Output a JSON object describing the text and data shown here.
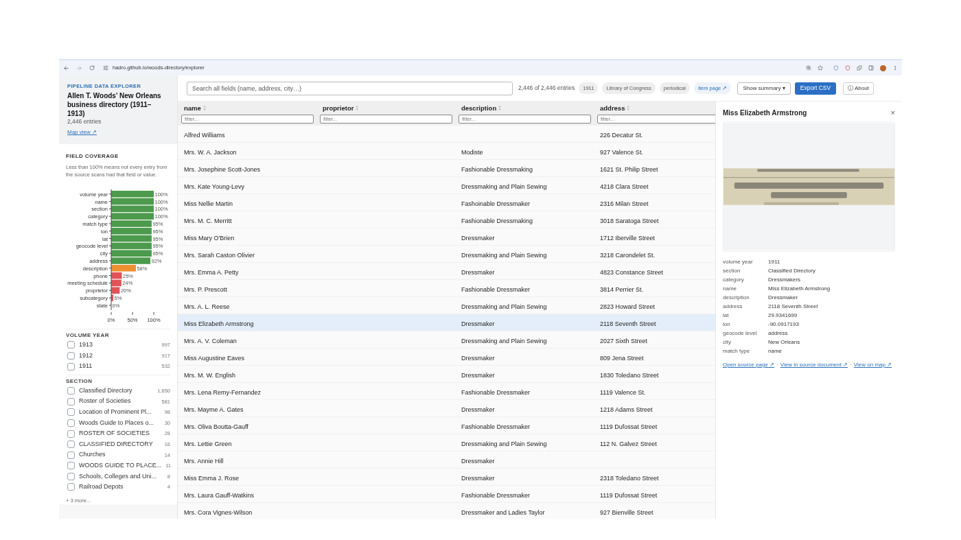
{
  "browser": {
    "url": "hadro.github.io/woods-directory/explorer"
  },
  "sidebar": {
    "eyebrow": "PIPELINE DATA EXPLORER",
    "title": "Allen T. Woods' New Orleans business directory (1911–1913)",
    "entries": "2,446 entries",
    "map_link": "Map view ↗",
    "coverage": {
      "heading": "FIELD COVERAGE",
      "note": "Less than 100% means not every entry from the source scans had that field or value.",
      "chart_data": {
        "type": "bar",
        "orientation": "horizontal",
        "categories": [
          "volume year",
          "name",
          "section",
          "category",
          "match type",
          "lon",
          "lat",
          "geocode level",
          "city",
          "address",
          "description",
          "phone",
          "meeting schedule",
          "proprietor",
          "subcategory",
          "state"
        ],
        "values": [
          100,
          100,
          100,
          100,
          95,
          95,
          95,
          95,
          95,
          92,
          58,
          25,
          24,
          20,
          5,
          0
        ],
        "value_labels": [
          "100%",
          "100%",
          "100%",
          "100%",
          "95%",
          "95%",
          "95%",
          "95%",
          "95%",
          "92%",
          "58%",
          "25%",
          "24%",
          "20%",
          "5%",
          "0%"
        ],
        "xlim": [
          0,
          100
        ],
        "xticks": [
          {
            "value": 0,
            "label": "0%"
          },
          {
            "value": 50,
            "label": "50%"
          },
          {
            "value": 100,
            "label": "100%"
          }
        ]
      }
    },
    "facets": [
      {
        "heading": "VOLUME YEAR",
        "items": [
          {
            "label": "1913",
            "count": "997",
            "checked": false
          },
          {
            "label": "1912",
            "count": "917",
            "checked": false
          },
          {
            "label": "1911",
            "count": "532",
            "checked": false
          }
        ]
      },
      {
        "heading": "SECTION",
        "items": [
          {
            "label": "Classified Directory",
            "count": "1,650",
            "checked": false
          },
          {
            "label": "Roster of Societies",
            "count": "581",
            "checked": false
          },
          {
            "label": "Location of Prominent Pl...",
            "count": "98",
            "checked": false
          },
          {
            "label": "Woods Guide to Places o...",
            "count": "30",
            "checked": false
          },
          {
            "label": "ROSTER OF SOCIETIES",
            "count": "28",
            "checked": false
          },
          {
            "label": "CLASSIFIED DIRECTORY",
            "count": "16",
            "checked": false
          },
          {
            "label": "Churches",
            "count": "14",
            "checked": false
          },
          {
            "label": "WOODS GUIDE TO PLACE...",
            "count": "11",
            "checked": false
          },
          {
            "label": "Schools, Colleges and Uni...",
            "count": "8",
            "checked": false
          },
          {
            "label": "Railroad Depots",
            "count": "4",
            "checked": false
          }
        ],
        "more": "+ 3 more..."
      }
    ]
  },
  "toolbar": {
    "search_placeholder": "Search all fields (name, address, city…)",
    "count": "2,446 of 2,446 entries",
    "tags": [
      "1911",
      "Library of Congress",
      "periodical"
    ],
    "item_link": "Item page ↗",
    "summary_button": "Show summary ▾",
    "export_button": "Export CSV",
    "about_button": "ⓘ About"
  },
  "table": {
    "columns": [
      {
        "label": "name",
        "filter_placeholder": "filter..."
      },
      {
        "label": "proprietor",
        "filter_placeholder": "filter..."
      },
      {
        "label": "description",
        "filter_placeholder": "filter..."
      },
      {
        "label": "address",
        "filter_placeholder": "filter..."
      }
    ],
    "rows": [
      {
        "cells": [
          "Alfred Williams",
          "",
          "",
          "226 Decatur St."
        ],
        "selected": false
      },
      {
        "cells": [
          "Mrs. W. A. Jackson",
          "",
          "Modiste",
          "927 Valence St."
        ],
        "selected": false
      },
      {
        "cells": [
          "Mrs. Josephine Scott-Jones",
          "",
          "Fashionable Dressmaking",
          "1621 St. Philip Street"
        ],
        "selected": false
      },
      {
        "cells": [
          "Mrs. Kate Young-Levy",
          "",
          "Dressmaking and Plain Sewing",
          "4218 Clara Street"
        ],
        "selected": false
      },
      {
        "cells": [
          "Miss Nellie Martin",
          "",
          "Fashoinable Dressmaker",
          "2316 Milan Street"
        ],
        "selected": false
      },
      {
        "cells": [
          "Mrs. M. C. Merritt",
          "",
          "Fashionable Dressmaking",
          "3018 Saratoga Street"
        ],
        "selected": false
      },
      {
        "cells": [
          "Miss Mary O'Brien",
          "",
          "Dressmaker",
          "1712 Iberville Street"
        ],
        "selected": false
      },
      {
        "cells": [
          "Mrs. Sarah Caston Olivier",
          "",
          "Dressmaking and Plain Sewing",
          "3218 Carondelet St."
        ],
        "selected": false
      },
      {
        "cells": [
          "Mrs. Emma A. Petty",
          "",
          "Dressmaker",
          "4823 Constance Street"
        ],
        "selected": false
      },
      {
        "cells": [
          "Mrs. P. Prescott",
          "",
          "Fashionable Dressmaker",
          "3814 Perrier St."
        ],
        "selected": false
      },
      {
        "cells": [
          "Mrs. A. L. Reese",
          "",
          "Dressmaking and Plain Sewing",
          "2823 Howard Street"
        ],
        "selected": false
      },
      {
        "cells": [
          "Miss Elizabeth Armstrong",
          "",
          "Dressmaker",
          "2118 Seventh Street"
        ],
        "selected": true
      },
      {
        "cells": [
          "Mrs. A. V. Coleman",
          "",
          "Dressmaking and Plain Sewing",
          "2027 Sixth Street"
        ],
        "selected": false
      },
      {
        "cells": [
          "Miss Augustine Eaves",
          "",
          "Dressmaker",
          "809 Jena Street"
        ],
        "selected": false
      },
      {
        "cells": [
          "Mrs. M. W. English",
          "",
          "Dressmaker",
          "1830 Toledano Street"
        ],
        "selected": false
      },
      {
        "cells": [
          "Mrs. Lena Remy-Fernandez",
          "",
          "Fashionable Dressmaker",
          "1119 Valence St."
        ],
        "selected": false
      },
      {
        "cells": [
          "Mrs. Mayme A. Gates",
          "",
          "Dressmaker",
          "1218 Adams Street"
        ],
        "selected": false
      },
      {
        "cells": [
          "Mrs. Oliva Boutta-Gauff",
          "",
          "Fashionable Dressmaker",
          "1119 Dufossat Street"
        ],
        "selected": false
      },
      {
        "cells": [
          "Mrs. Lettie Green",
          "",
          "Dressmaking and Plain Sewing",
          "112 N. Galvez Street"
        ],
        "selected": false
      },
      {
        "cells": [
          "Mrs. Annie Hill",
          "",
          "Dressmaker",
          ""
        ],
        "selected": false
      },
      {
        "cells": [
          "Miss Emma J. Rose",
          "",
          "Dressmaker",
          "2318 Toledano Street"
        ],
        "selected": false
      },
      {
        "cells": [
          "Mrs. Laura Gauff-Watkins",
          "",
          "Fashionable Dressmaker",
          "1119 Dufossat Street"
        ],
        "selected": false
      },
      {
        "cells": [
          "Mrs. Cora Vignes-Wilson",
          "",
          "Dressmaker and Ladies Taylor",
          "927 Bienville Street"
        ],
        "selected": false
      }
    ]
  },
  "detail": {
    "title": "Miss Elizabeth Armstrong",
    "close": "×",
    "image": {
      "kind": "picture"
    },
    "fields": [
      {
        "key": "volume year",
        "value": "1911"
      },
      {
        "key": "section",
        "value": "Classified Directory"
      },
      {
        "key": "category",
        "value": "Dressmakers"
      },
      {
        "key": "name",
        "value": "Miss Elizabeth Armstrong"
      },
      {
        "key": "description",
        "value": "Dressmaker"
      },
      {
        "key": "address",
        "value": "2118 Seventh Street"
      },
      {
        "key": "lat",
        "value": "29.9341699"
      },
      {
        "key": "lon",
        "value": "-90.0917193"
      },
      {
        "key": "geocode level",
        "value": "address"
      },
      {
        "key": "city",
        "value": "New Orleans"
      },
      {
        "key": "match type",
        "value": "name"
      }
    ],
    "links": [
      "Open source page ↗",
      "View in source document ↗",
      "View on map ↗"
    ],
    "separator": "·"
  }
}
